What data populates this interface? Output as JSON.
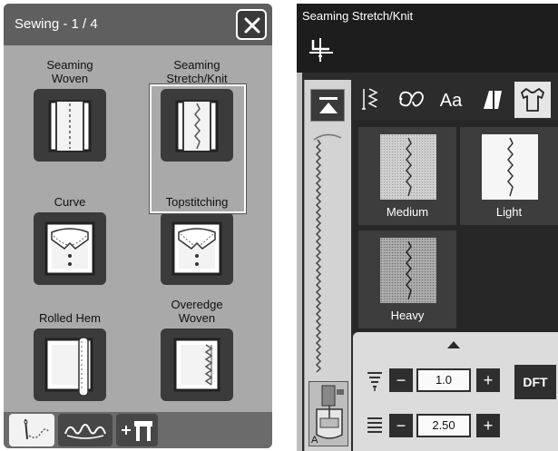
{
  "left_panel": {
    "title": "Sewing - 1 / 4",
    "close_icon": "close-x-icon",
    "stitches": [
      {
        "label": "Seaming\nWoven",
        "icon": "straight-stitch-icon"
      },
      {
        "label": "Seaming\nStretch/Knit",
        "icon": "stretch-stitch-icon",
        "selected": true
      },
      {
        "label": "Curve",
        "icon": "collar-icon"
      },
      {
        "label": "Topstitching",
        "icon": "collar-topstitch-icon"
      },
      {
        "label": "Rolled Hem",
        "icon": "rolled-hem-icon"
      },
      {
        "label": "Overedge\nWoven",
        "icon": "overedge-stitch-icon"
      }
    ],
    "bottom_tabs": [
      "needle-thread-icon",
      "decorative-stitch-icon",
      "add-buttonhole-icon"
    ]
  },
  "right_panel": {
    "title": "Seaming Stretch/Knit",
    "needle_icon": "needle-position-icon",
    "top_button_icon": "top-of-stitch-icon",
    "presser_foot_letter": "A",
    "tabs": [
      {
        "icon": "stitch-pattern-icon",
        "selected": false
      },
      {
        "icon": "decorative-loop-icon",
        "selected": false
      },
      {
        "icon": "font-icon",
        "label": "Aa",
        "selected": false
      },
      {
        "icon": "quilt-block-icon",
        "selected": false
      },
      {
        "icon": "garment-icon",
        "selected": true
      }
    ],
    "fabrics": [
      {
        "label": "Medium"
      },
      {
        "label": "Light"
      },
      {
        "label": "Heavy"
      }
    ],
    "settings": {
      "stitch_width_value": "1.0",
      "stitch_length_value": "2.50",
      "minus": "−",
      "plus": "+",
      "default_button": "DFT"
    }
  }
}
